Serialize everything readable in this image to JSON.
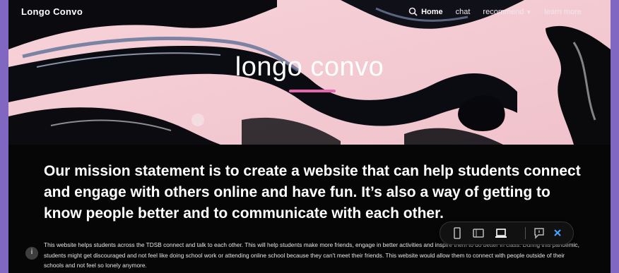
{
  "site": {
    "brand": "Longo Convo",
    "nav": [
      {
        "label": "Home",
        "active": true
      },
      {
        "label": "chat",
        "active": false
      },
      {
        "label": "recommend",
        "active": false,
        "has_dropdown": true
      },
      {
        "label": "learn more",
        "active": false
      }
    ]
  },
  "hero": {
    "title": "longo convo",
    "accent_color": "#e667b0"
  },
  "mission": {
    "heading": "Our mission statement is to create a website that can help students connect and engage with others online and have fun. It’s also a way of getting to know people better and to communicate with each other.",
    "body": "This website helps students across the TDSB connect and talk to each other. This will help students make more friends, engage in better activities and inspire them to do better in class. During this pandemic, students might get discouraged and not feel like doing school work or attending online school because they can't meet their friends. This website would allow them to connect with people outside of their schools and not feel so lonely anymore."
  },
  "preview_toolbar": {
    "buttons": [
      "phone-view-icon",
      "tablet-view-icon",
      "laptop-view-icon",
      "feedback-icon",
      "close-icon"
    ]
  },
  "info_button": {
    "label": "i"
  },
  "colors": {
    "frame": "#7f67c2",
    "background": "#060606",
    "hero_pink": "#f2c6cf"
  }
}
